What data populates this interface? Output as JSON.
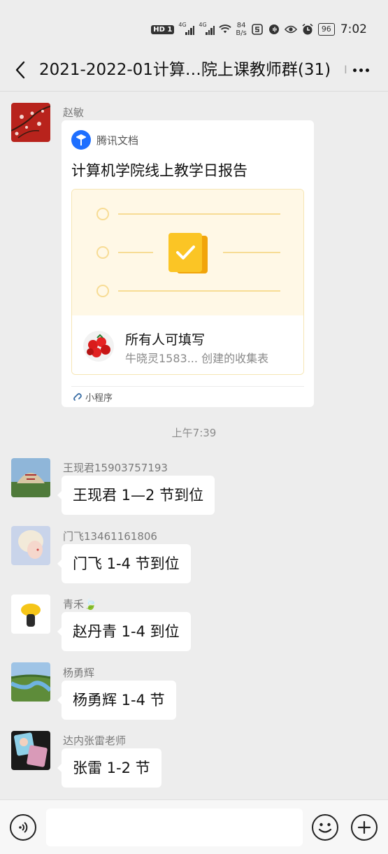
{
  "status_bar": {
    "hd": "HD",
    "sim1": "1",
    "net1": "4G",
    "net2": "4G",
    "speed_value": "84",
    "speed_unit": "B/s",
    "battery": "96",
    "time": "7:02",
    "icons": [
      "wifi-icon",
      "soul-app-icon",
      "audio-app-icon",
      "eye-icon",
      "alarm-icon"
    ]
  },
  "header": {
    "title": "2021-2022-01计算…院上课教师群(31)"
  },
  "card_message": {
    "sender": "赵敏",
    "source": "腾讯文档",
    "title": "计算机学院线上教学日报告",
    "fill_label": "所有人可填写",
    "creator": "牛晓灵1583... 创建的收集表",
    "footer": "小程序"
  },
  "timestamp": "上午7:39",
  "messages": [
    {
      "sender": "王现君15903757193",
      "text": "王现君 1—2 节到位"
    },
    {
      "sender": "门飞13461161806",
      "text": "门飞 1-4 节到位"
    },
    {
      "sender": "青禾🍃",
      "text": "赵丹青 1-4 到位"
    },
    {
      "sender": "杨勇辉",
      "text": "杨勇辉 1-4 节"
    },
    {
      "sender": "达内张雷老师",
      "text": "张雷 1-2 节"
    }
  ],
  "colors": {
    "background": "#ededed",
    "bubble": "#ffffff",
    "accent_yellow": "#f7c21c",
    "tencent_blue": "#1e6fff"
  }
}
